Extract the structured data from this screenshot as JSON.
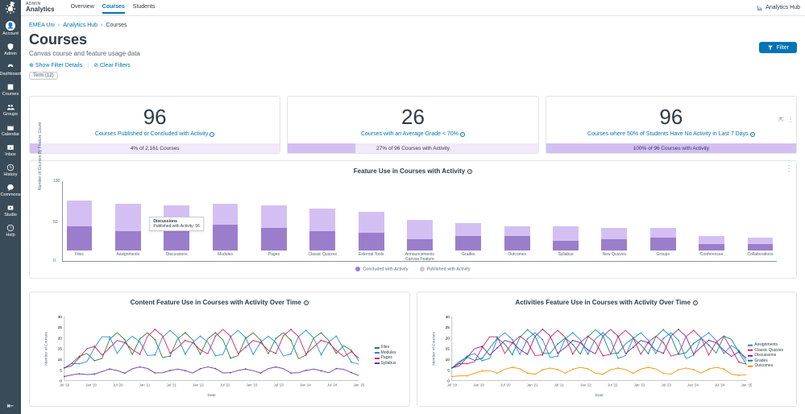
{
  "brand": {
    "sup": "ADMIN",
    "name": "Analytics"
  },
  "topnav": {
    "overview": "Overview",
    "courses": "Courses",
    "students": "Students"
  },
  "hub_link": "Analytics Hub",
  "global_nav": {
    "account": "Account",
    "admin": "Admin",
    "dashboard": "Dashboard",
    "courses": "Courses",
    "groups": "Groups",
    "calendar": "Calendar",
    "inbox": "Inbox",
    "history": "History",
    "commons": "Commons",
    "studio": "Studio",
    "help": "Help"
  },
  "breadcrumb": {
    "root": "EMEA Uni",
    "hub": "Analytics Hub",
    "current": "Courses"
  },
  "page": {
    "title": "Courses",
    "subtitle": "Canvas course and feature usage data"
  },
  "filters": {
    "show": "Show Filter Details",
    "clear": "Clear Filters",
    "chip": "Term (12)",
    "button": "Filter"
  },
  "kpis": [
    {
      "value": "96",
      "label": "Courses Published or Concluded with Activity",
      "progress_text": "4% of 2,161 Courses",
      "progress_pct": 4
    },
    {
      "value": "26",
      "label": "Courses with an Average Grade < 70%",
      "progress_text": "27% of 96 Courses with Activity",
      "progress_pct": 27
    },
    {
      "value": "96",
      "label": "Courses where 50% of Students Have No Activity in Last 7 Days",
      "progress_text": "100% of 96 Courses with Activity",
      "progress_pct": 100
    }
  ],
  "chart_data": {
    "feature_use": {
      "type": "bar_stacked",
      "title": "Feature Use in Courses with Activity",
      "ylabel": "Number of Courses By Feature Count",
      "ylim": [
        0,
        100
      ],
      "legend": [
        "Concluded with Activity",
        "Published with Activity"
      ],
      "categories": [
        "Files",
        "Assignments",
        "Discussions",
        "Modules",
        "Pages",
        "Classic Quizzes",
        "External Tools",
        "Announcements Canvas Feature",
        "Grades",
        "Outcomes",
        "Syllabus",
        "New Quizzes",
        "Groups",
        "Conferences",
        "Collaborations"
      ],
      "series": [
        {
          "name": "Concluded with Activity",
          "values": [
            30,
            24,
            24,
            32,
            28,
            24,
            22,
            14,
            18,
            18,
            12,
            14,
            16,
            8,
            8
          ]
        },
        {
          "name": "Published with Activity",
          "values": [
            62,
            58,
            56,
            58,
            56,
            52,
            48,
            38,
            34,
            30,
            30,
            28,
            28,
            18,
            16
          ]
        }
      ],
      "tooltip": {
        "index": 2,
        "lines": [
          "Discussions",
          "Published with Activity: 56"
        ]
      }
    },
    "content_over_time": {
      "type": "line",
      "title": "Content Feature Use in Courses with Activity Over Time",
      "xlabel": "Date",
      "ylabel": "Number of Courses",
      "ylim": [
        0,
        30
      ],
      "xticks": [
        "Jul '19",
        "Jan '20",
        "Jul '20",
        "Jan '21",
        "Jul '21",
        "Jan '22",
        "Jul '22",
        "Jan '23",
        "Jul '23",
        "Jan '24",
        "Jul '24",
        "Jan '25"
      ],
      "series_names": [
        "Files",
        "Modules",
        "Pages",
        "Syllabus"
      ],
      "colors": [
        "#2e7d32",
        "#1e88e5",
        "#d81b60",
        "#5e35b1"
      ]
    },
    "activities_over_time": {
      "type": "line",
      "title": "Activities Feature Use in Courses with Activity Over Time",
      "xlabel": "Date",
      "ylabel": "Number of Courses",
      "ylim": [
        0,
        30
      ],
      "xticks": [
        "Jul '19",
        "Jan '20",
        "Jul '20",
        "Jan '21",
        "Jul '21",
        "Jan '22",
        "Jul '22",
        "Jan '23",
        "Jul '23",
        "Jan '24",
        "Jul '24",
        "Jan '25"
      ],
      "series_names": [
        "Assignments",
        "Classic Quizzes",
        "Discussions",
        "Grades",
        "Outcomes"
      ],
      "colors": [
        "#1e88e5",
        "#d81b60",
        "#7b1fa2",
        "#00897b",
        "#fb8c00"
      ]
    }
  }
}
